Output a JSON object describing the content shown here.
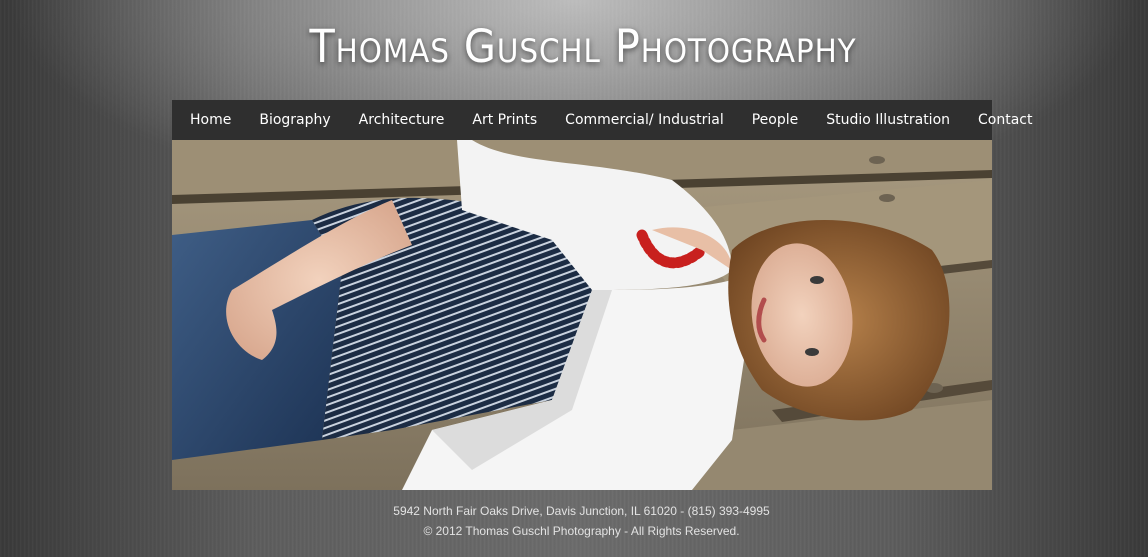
{
  "header": {
    "title": "Thomas Guschl Photography"
  },
  "nav": {
    "items": [
      {
        "label": "Home",
        "name": "nav-home"
      },
      {
        "label": "Biography",
        "name": "nav-biography"
      },
      {
        "label": "Architecture",
        "name": "nav-architecture"
      },
      {
        "label": "Art Prints",
        "name": "nav-art-prints"
      },
      {
        "label": "Commercial/ Industrial",
        "name": "nav-commercial-industrial"
      },
      {
        "label": "People",
        "name": "nav-people"
      },
      {
        "label": "Studio Illustration",
        "name": "nav-studio-illustration"
      },
      {
        "label": "Contact",
        "name": "nav-contact"
      }
    ]
  },
  "hero": {
    "subject": "portrait photo of a young woman lying on a wooden bench"
  },
  "footer": {
    "address": "5942 North Fair Oaks Drive, Davis Junction, IL 61020 - (815) 393-4995",
    "copyright": "© 2012 Thomas Guschl Photography - All Rights Reserved."
  },
  "colors": {
    "nav_background": "#2f2f2f",
    "text": "#ffffff",
    "footer_text": "#e2e2e2"
  }
}
